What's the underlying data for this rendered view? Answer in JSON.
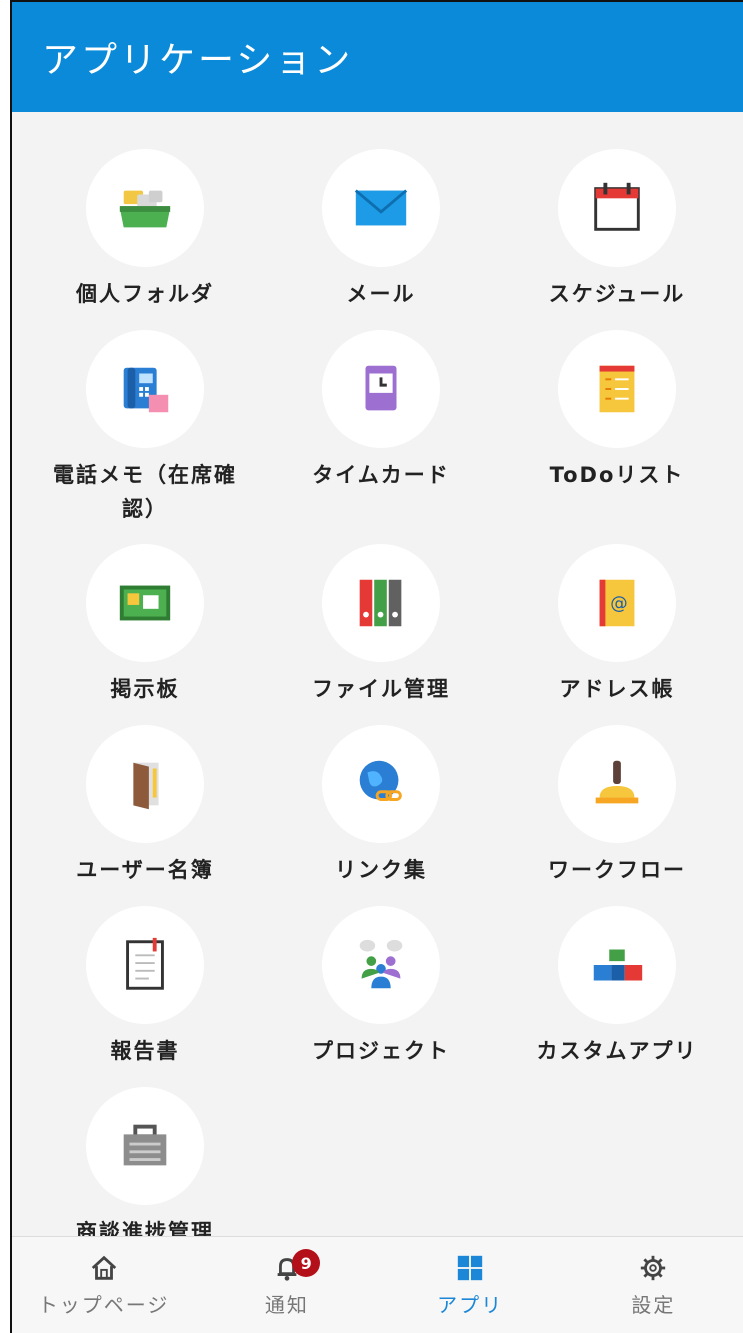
{
  "header": {
    "title": "アプリケーション"
  },
  "apps": [
    {
      "label": "個人フォルダ",
      "icon": "personal-folder-icon"
    },
    {
      "label": "メール",
      "icon": "mail-icon"
    },
    {
      "label": "スケジュール",
      "icon": "calendar-icon"
    },
    {
      "label": "電話メモ（在席確認）",
      "icon": "phone-memo-icon"
    },
    {
      "label": "タイムカード",
      "icon": "timecard-icon"
    },
    {
      "label": "ToDoリスト",
      "icon": "todo-list-icon"
    },
    {
      "label": "掲示板",
      "icon": "bulletin-board-icon"
    },
    {
      "label": "ファイル管理",
      "icon": "file-binders-icon"
    },
    {
      "label": "アドレス帳",
      "icon": "address-book-icon"
    },
    {
      "label": "ユーザー名簿",
      "icon": "door-icon"
    },
    {
      "label": "リンク集",
      "icon": "globe-link-icon"
    },
    {
      "label": "ワークフロー",
      "icon": "stamp-icon"
    },
    {
      "label": "報告書",
      "icon": "report-icon"
    },
    {
      "label": "プロジェクト",
      "icon": "project-team-icon"
    },
    {
      "label": "カスタムアプリ",
      "icon": "blocks-icon"
    },
    {
      "label": "商談進捗管理",
      "icon": "toolbox-icon"
    }
  ],
  "nav": {
    "home": "トップページ",
    "notifications": "通知",
    "notification_count": "9",
    "apps": "アプリ",
    "settings": "設定",
    "active_color": "#1b87d6"
  }
}
